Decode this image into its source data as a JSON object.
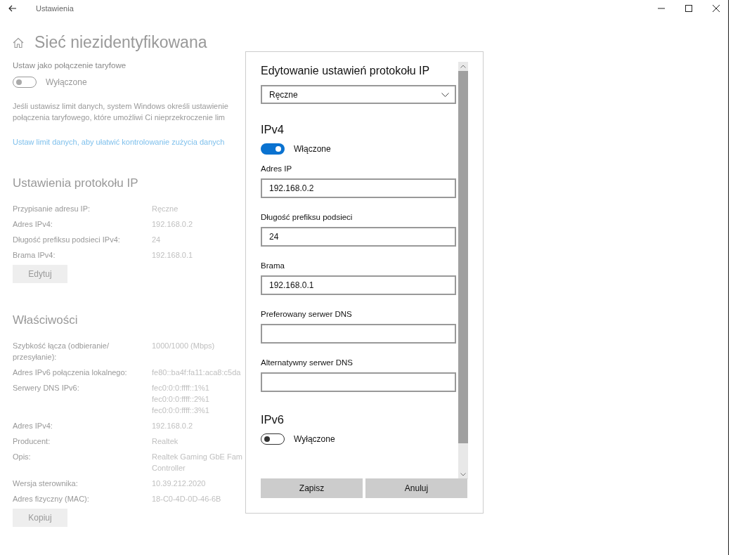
{
  "title_bar": {
    "title": "Ustawienia"
  },
  "page": {
    "title": "Sieć niezidentyfikowana",
    "metered": {
      "label": "Ustaw jako połączenie taryfowe",
      "toggle": {
        "on": false,
        "state_label": "Wyłączone"
      }
    },
    "description_lines": [
      "Jeśli ustawisz limit danych, system Windows określi ustawienie",
      "połączenia taryfowego, które umożliwi Ci nieprzekroczenie lim"
    ],
    "link": "Ustaw limit danych, aby ułatwić kontrolowanie zużycia danych",
    "ip_settings": {
      "heading": "Ustawienia protokołu IP",
      "rows": [
        {
          "label": "Przypisanie adresu IP:",
          "values": [
            "Ręczne"
          ]
        },
        {
          "label": "Adres IPv4:",
          "values": [
            "192.168.0.2"
          ]
        },
        {
          "label": "Długość prefiksu podsieci IPv4:",
          "values": [
            "24"
          ]
        },
        {
          "label": "Brama IPv4:",
          "values": [
            "192.168.0.1"
          ]
        }
      ],
      "button": "Edytuj"
    },
    "properties": {
      "heading": "Właściwości",
      "rows": [
        {
          "label": "Szybkość łącza (odbieranie/ przesyłanie):",
          "values": [
            "1000/1000 (Mbps)"
          ]
        },
        {
          "label": "Adres IPv6 połączenia lokalnego:",
          "values": [
            "fe80::ba4f:fa11:aca8:c5da"
          ]
        },
        {
          "label": "Serwery DNS IPv6:",
          "values": [
            "fec0:0:0:ffff::1%1",
            "fec0:0:0:ffff::2%1",
            "fec0:0:0:ffff::3%1"
          ]
        },
        {
          "label": "Adres IPv4:",
          "values": [
            "192.168.0.2"
          ]
        },
        {
          "label": "Producent:",
          "values": [
            "Realtek"
          ]
        },
        {
          "label": "Opis:",
          "values": [
            "Realtek Gaming GbE Fam",
            "Controller"
          ]
        },
        {
          "label": "Wersja sterownika:",
          "values": [
            "10.39.212.2020"
          ]
        },
        {
          "label": "Adres fizyczny (MAC):",
          "values": [
            "18-C0-4D-0D-46-6B"
          ]
        }
      ],
      "button": "Kopiuj"
    }
  },
  "dialog": {
    "title": "Edytowanie ustawień protokołu IP",
    "select": {
      "value": "Ręczne"
    },
    "ipv4": {
      "heading": "IPv4",
      "toggle": {
        "on": true,
        "state_label": "Włączone"
      },
      "fields": [
        {
          "label": "Adres IP",
          "value": "192.168.0.2"
        },
        {
          "label": "Długość prefiksu podsieci",
          "value": "24"
        },
        {
          "label": "Brama",
          "value": "192.168.0.1"
        },
        {
          "label": "Preferowany serwer DNS"
        },
        {
          "label": "Alternatywny serwer DNS"
        }
      ]
    },
    "ipv6": {
      "heading": "IPv6",
      "toggle": {
        "on": false,
        "state_label": "Wyłączone"
      }
    },
    "buttons": [
      "Zapisz",
      "Anuluj"
    ]
  }
}
